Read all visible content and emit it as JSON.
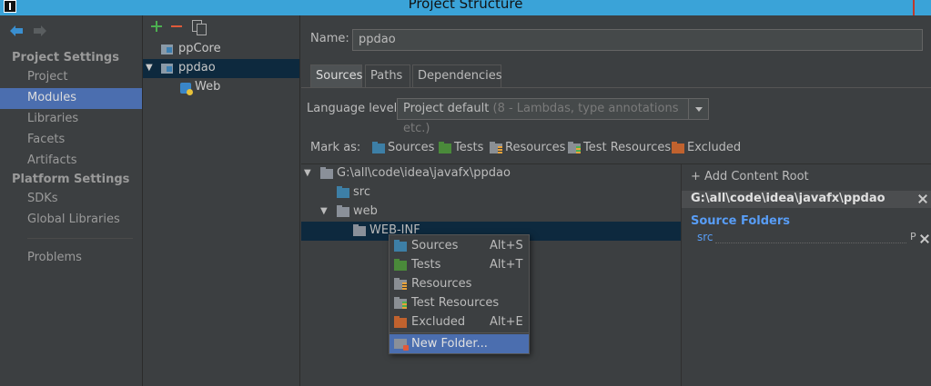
{
  "window": {
    "title": "Project Structure"
  },
  "nav": {
    "project_settings": "Project Settings",
    "project_items": [
      "Project",
      "Modules",
      "Libraries",
      "Facets",
      "Artifacts"
    ],
    "platform_settings": "Platform Settings",
    "platform_items": [
      "SDKs",
      "Global Libraries"
    ],
    "problems": "Problems",
    "selected": "Modules"
  },
  "modules": {
    "items": [
      {
        "label": "ppCore"
      },
      {
        "label": "ppdao",
        "expanded": true,
        "selected": true
      },
      {
        "label": "Web"
      }
    ]
  },
  "module_settings": {
    "name_label": "Name:",
    "name_value": "ppdao",
    "tabs": [
      "Sources",
      "Paths",
      "Dependencies"
    ],
    "active_tab": "Sources",
    "language_level_label": "Language level:",
    "language_level_value": "Project default",
    "language_level_hint": "(8 - Lambdas, type annotations etc.)",
    "mark_as_label": "Mark as:",
    "mark_as": [
      "Sources",
      "Tests",
      "Resources",
      "Test Resources",
      "Excluded"
    ]
  },
  "tree": {
    "root": "G:\\all\\code\\idea\\javafx\\ppdao",
    "src": "src",
    "web": "web",
    "web_inf": "WEB-INF"
  },
  "roots": {
    "add_label": "Add Content Root",
    "root_path": "G:\\all\\code\\idea\\javafx\\ppdao",
    "source_folders_title": "Source Folders",
    "source_folder": "src",
    "source_folder_flag": "P"
  },
  "context_menu": {
    "items": [
      {
        "label": "Sources",
        "shortcut": "Alt+S"
      },
      {
        "label": "Tests",
        "shortcut": "Alt+T"
      },
      {
        "label": "Resources",
        "shortcut": ""
      },
      {
        "label": "Test Resources",
        "shortcut": ""
      },
      {
        "label": "Excluded",
        "shortcut": "Alt+E"
      },
      {
        "label": "New Folder...",
        "shortcut": ""
      }
    ],
    "highlighted": "New Folder..."
  },
  "colors": {
    "titlebar": "#3aa3d8",
    "selection": "#4b6eaf",
    "tree_selection": "#0d293e",
    "link_blue": "#589df6"
  }
}
